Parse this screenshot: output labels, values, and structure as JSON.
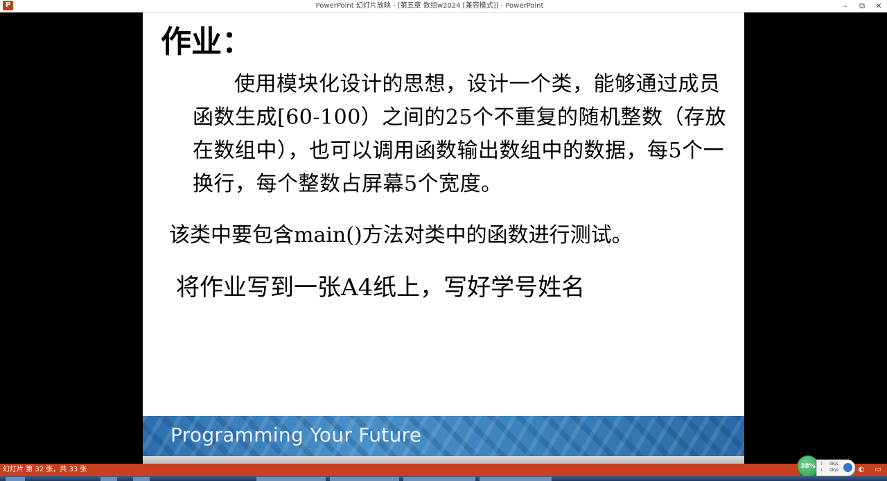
{
  "window": {
    "title": "PowerPoint 幻灯片放映 - [第五章 数组w2024 [兼容模式]] - PowerPoint",
    "app_icon_label": "P",
    "controls": {
      "minimize": "–",
      "restore": "⧉",
      "close": "✕"
    }
  },
  "slide": {
    "heading": "作业：",
    "paragraph": "使用模块化设计的思想，设计一个类，能够通过成员函数生成[60-100）之间的25个不重复的随机整数（存放在数组中），也可以调用函数输出数组中的数据，每5个一换行，每个整数占屏幕5个宽度。",
    "line2": "该类中要包含main()方法对类中的函数进行测试。",
    "line3": "将作业写到一张A4纸上，写好学号姓名",
    "banner_text": "Programming Your Future"
  },
  "statusbar": {
    "slide_info": "幻灯片 第 32 张，共 33 张",
    "icons": [
      "prev-icon",
      "notes-icon",
      "reading-view-icon",
      "slideshow-icon"
    ]
  },
  "network_widget": {
    "percent": "38%",
    "upload": "0K/s",
    "download": "0K/s"
  },
  "colors": {
    "statusbar": "#c8401e",
    "banner": "#3a82bd",
    "slide_bg": "#ffffff"
  }
}
